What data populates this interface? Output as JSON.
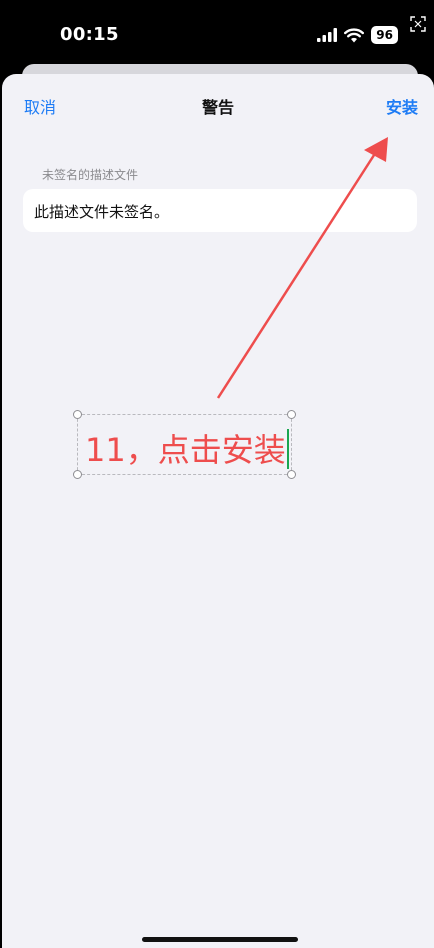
{
  "status_bar": {
    "time": "00:15",
    "battery": "96"
  },
  "nav": {
    "cancel_label": "取消",
    "title": "警告",
    "install_label": "安装"
  },
  "section": {
    "header": "未签名的描述文件",
    "message": "此描述文件未签名。"
  },
  "annotation": {
    "text": "11，点击安装"
  },
  "colors": {
    "accent": "#1e7cf5",
    "annotation": "#ee4d4d",
    "background": "#f2f2f7"
  }
}
